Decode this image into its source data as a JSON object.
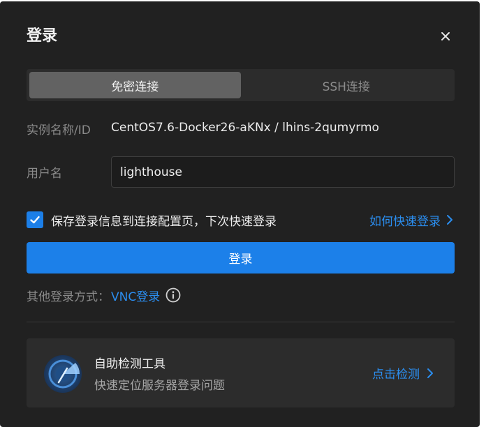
{
  "dialog": {
    "title": "登录"
  },
  "tabs": [
    {
      "label": "免密连接",
      "active": true
    },
    {
      "label": "SSH连接",
      "active": false
    }
  ],
  "instance": {
    "label": "实例名称/ID",
    "value": "CentOS7.6-Docker26-aKNx / lhins-2qumyrmo"
  },
  "username": {
    "label": "用户名",
    "value": "lighthouse"
  },
  "save_option": {
    "checked": true,
    "label": "保存登录信息到连接配置页，下次快速登录"
  },
  "quick_login_link": "如何快速登录",
  "login_button": "登录",
  "other_methods": {
    "label": "其他登录方式：",
    "vnc_link": "VNC登录"
  },
  "self_check": {
    "title": "自助检测工具",
    "subtitle": "快速定位服务器登录问题",
    "link": "点击检测"
  },
  "colors": {
    "accent": "#1c80e9",
    "link": "#2b8ef0",
    "dialog_bg": "#212121"
  },
  "icons": [
    "close-icon",
    "checkmark-icon",
    "chevron-right-icon",
    "info-icon",
    "radar-icon"
  ]
}
